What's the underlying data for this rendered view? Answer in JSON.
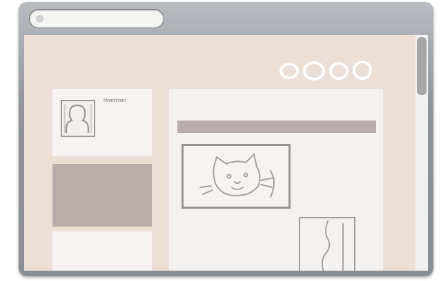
{
  "browser": {
    "address_bar": {
      "value": "",
      "placeholder": ""
    }
  },
  "sidebar": {
    "profile_name": "Mmmmmm"
  },
  "content": {
    "title": ""
  },
  "nav": {
    "circles": [
      "circle-1",
      "circle-2",
      "circle-3",
      "circle-4"
    ]
  },
  "colors": {
    "page_background": "#ebdfd6",
    "panel": "#f4f2f1",
    "placeholder_block": "#b8adaa",
    "chrome": "#8e9397",
    "sketch_line": "#9b938f"
  }
}
